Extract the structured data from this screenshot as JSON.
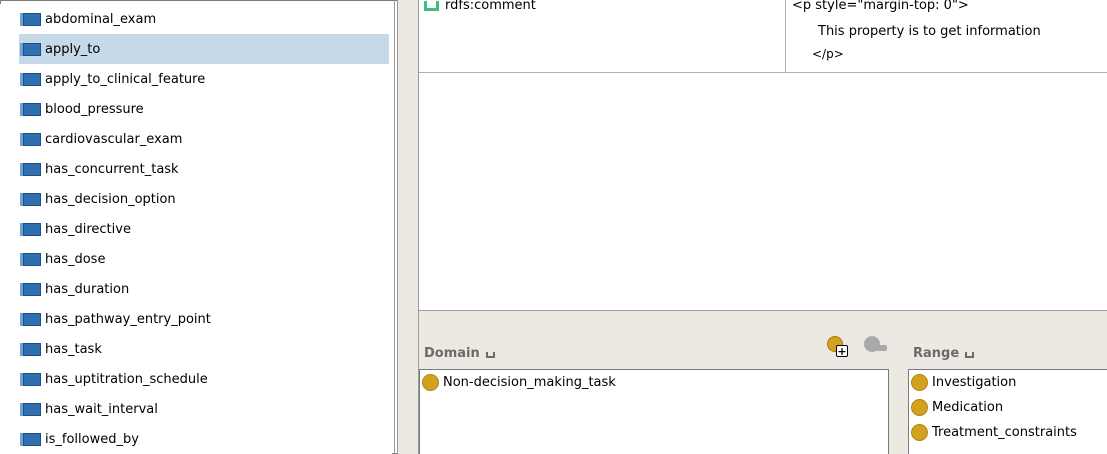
{
  "property_list": {
    "items": [
      {
        "label": "abdominal_exam"
      },
      {
        "label": "apply_to"
      },
      {
        "label": "apply_to_clinical_feature"
      },
      {
        "label": "blood_pressure"
      },
      {
        "label": "cardiovascular_exam"
      },
      {
        "label": "has_concurrent_task"
      },
      {
        "label": "has_decision_option"
      },
      {
        "label": "has_directive"
      },
      {
        "label": "has_dose"
      },
      {
        "label": "has_duration"
      },
      {
        "label": "has_pathway_entry_point"
      },
      {
        "label": "has_task"
      },
      {
        "label": "has_uptitration_schedule"
      },
      {
        "label": "has_wait_interval"
      },
      {
        "label": "is_followed_by"
      }
    ],
    "selected": "apply_to"
  },
  "annotations": {
    "property": "rdfs:comment",
    "value_line1": "<p style=\"margin-top: 0\">",
    "value_line2": "This property is to get information",
    "value_line3": "</p>"
  },
  "domain": {
    "title": "Domain",
    "items": [
      "Non-decision_making_task"
    ]
  },
  "range": {
    "title": "Range",
    "items": [
      "Investigation",
      "Medication",
      "Treatment_constraints"
    ]
  },
  "icons": {
    "property": "object-property-icon",
    "class": "class-icon",
    "add": "add-class-icon",
    "remove": "remove-class-icon"
  },
  "colors": {
    "selection": "#c5d9e8",
    "property_icon": "#2f6fb0",
    "class_icon": "#d4a020",
    "panel_bg": "#ebe9e2"
  }
}
